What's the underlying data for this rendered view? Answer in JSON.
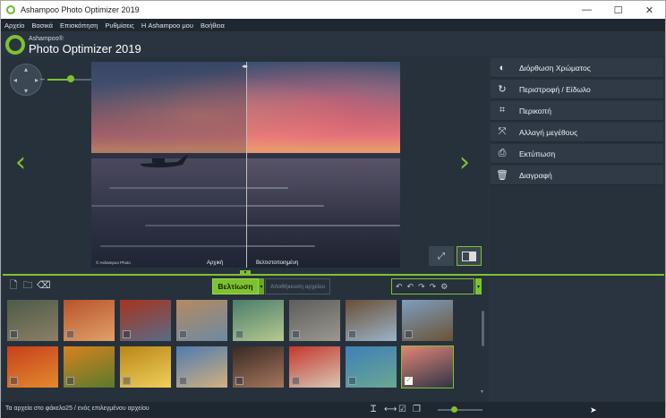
{
  "window": {
    "title": "Ashampoo Photo Optimizer 2019",
    "minimize": "—",
    "maximize": "☐",
    "close": "✕"
  },
  "menu": [
    "Αρχείο",
    "Βασικά",
    "Επισκόπηση",
    "Ρυθμίσεις",
    "Η Ashampoo μου",
    "Βοήθεια"
  ],
  "brand": {
    "small": "Ashampoo®",
    "big": "Photo Optimizer 2019"
  },
  "viewer": {
    "label_original": "Αρχική",
    "label_optimized": "Βελτιστοποιημένη",
    "credit": "© Ashampoo Photo",
    "zoom_minus": "–",
    "zoom_plus": "+",
    "zoom_level_fraction": 0.35,
    "prev_arrow": "‹",
    "next_arrow": "›",
    "fullscreen_icon": "⤢"
  },
  "actions": [
    {
      "label": "Διόρθωση Χρώματος",
      "icon": "color-correction-icon",
      "glyph": "◐"
    },
    {
      "label": "Περιστροφή / Είδωλο",
      "icon": "rotate-icon",
      "glyph": "↻"
    },
    {
      "label": "Περικοπή",
      "icon": "crop-icon",
      "glyph": "⌗"
    },
    {
      "label": "Αλλαγή μεγέθους",
      "icon": "resize-icon",
      "glyph": "⤧"
    },
    {
      "label": "Εκτύπωση",
      "icon": "print-icon",
      "glyph": "⎙"
    },
    {
      "label": "Διαγραφή",
      "icon": "delete-icon",
      "glyph": "🗑"
    }
  ],
  "toolbar": {
    "enhance_label": "Βελτίωση",
    "save_label": "Αποθήκευση αρχείου",
    "caret": "▾",
    "history_glyphs": [
      "↶",
      "↶",
      "↷",
      "↷",
      "⚙"
    ]
  },
  "thumbnails": [
    {
      "name": "ruins",
      "colors": [
        "#4d5b48",
        "#8c7f66"
      ],
      "selected": false
    },
    {
      "name": "canyon",
      "colors": [
        "#b8532c",
        "#e1a168"
      ],
      "selected": false
    },
    {
      "name": "red-leaves",
      "colors": [
        "#a6341e",
        "#5a6b86"
      ],
      "selected": false
    },
    {
      "name": "town",
      "colors": [
        "#b58a5e",
        "#6d8aa4"
      ],
      "selected": false
    },
    {
      "name": "peacock",
      "colors": [
        "#4a7d6d",
        "#b6c98d"
      ],
      "selected": false
    },
    {
      "name": "stone-face",
      "colors": [
        "#5d5d5a",
        "#9a9890"
      ],
      "selected": false
    },
    {
      "name": "tree",
      "colors": [
        "#6a4e36",
        "#9bb4c9"
      ],
      "selected": false
    },
    {
      "name": "barn",
      "colors": [
        "#7e9ec0",
        "#6b5236"
      ],
      "selected": false
    },
    {
      "name": "autumn-leaf",
      "colors": [
        "#c7401c",
        "#e38a2e"
      ],
      "selected": false
    },
    {
      "name": "flowers",
      "colors": [
        "#d8821f",
        "#5a7a2c"
      ],
      "selected": false
    },
    {
      "name": "golden-statue",
      "colors": [
        "#b88717",
        "#f1cf5a"
      ],
      "selected": false
    },
    {
      "name": "temple",
      "colors": [
        "#4f7bb0",
        "#d1b17f"
      ],
      "selected": false
    },
    {
      "name": "woman",
      "colors": [
        "#3a2a24",
        "#a5765c"
      ],
      "selected": false
    },
    {
      "name": "man-turban",
      "colors": [
        "#c4382d",
        "#d9c7b5"
      ],
      "selected": false
    },
    {
      "name": "beach",
      "colors": [
        "#3f7fb8",
        "#69a891"
      ],
      "selected": false
    },
    {
      "name": "sunset-boat",
      "colors": [
        "#e28576",
        "#2f3446"
      ],
      "selected": true
    }
  ],
  "status": {
    "text": "Τα αρχεία στο φάκελο25 / ενός επιλεγμένου αρχείου",
    "icons": [
      "Ꮖ",
      "⟷",
      "☑",
      "❐"
    ],
    "zoom_fraction": 0.35
  },
  "colors": {
    "accent": "#7ec230",
    "panel": "#27313c",
    "bar": "#1f2731"
  }
}
